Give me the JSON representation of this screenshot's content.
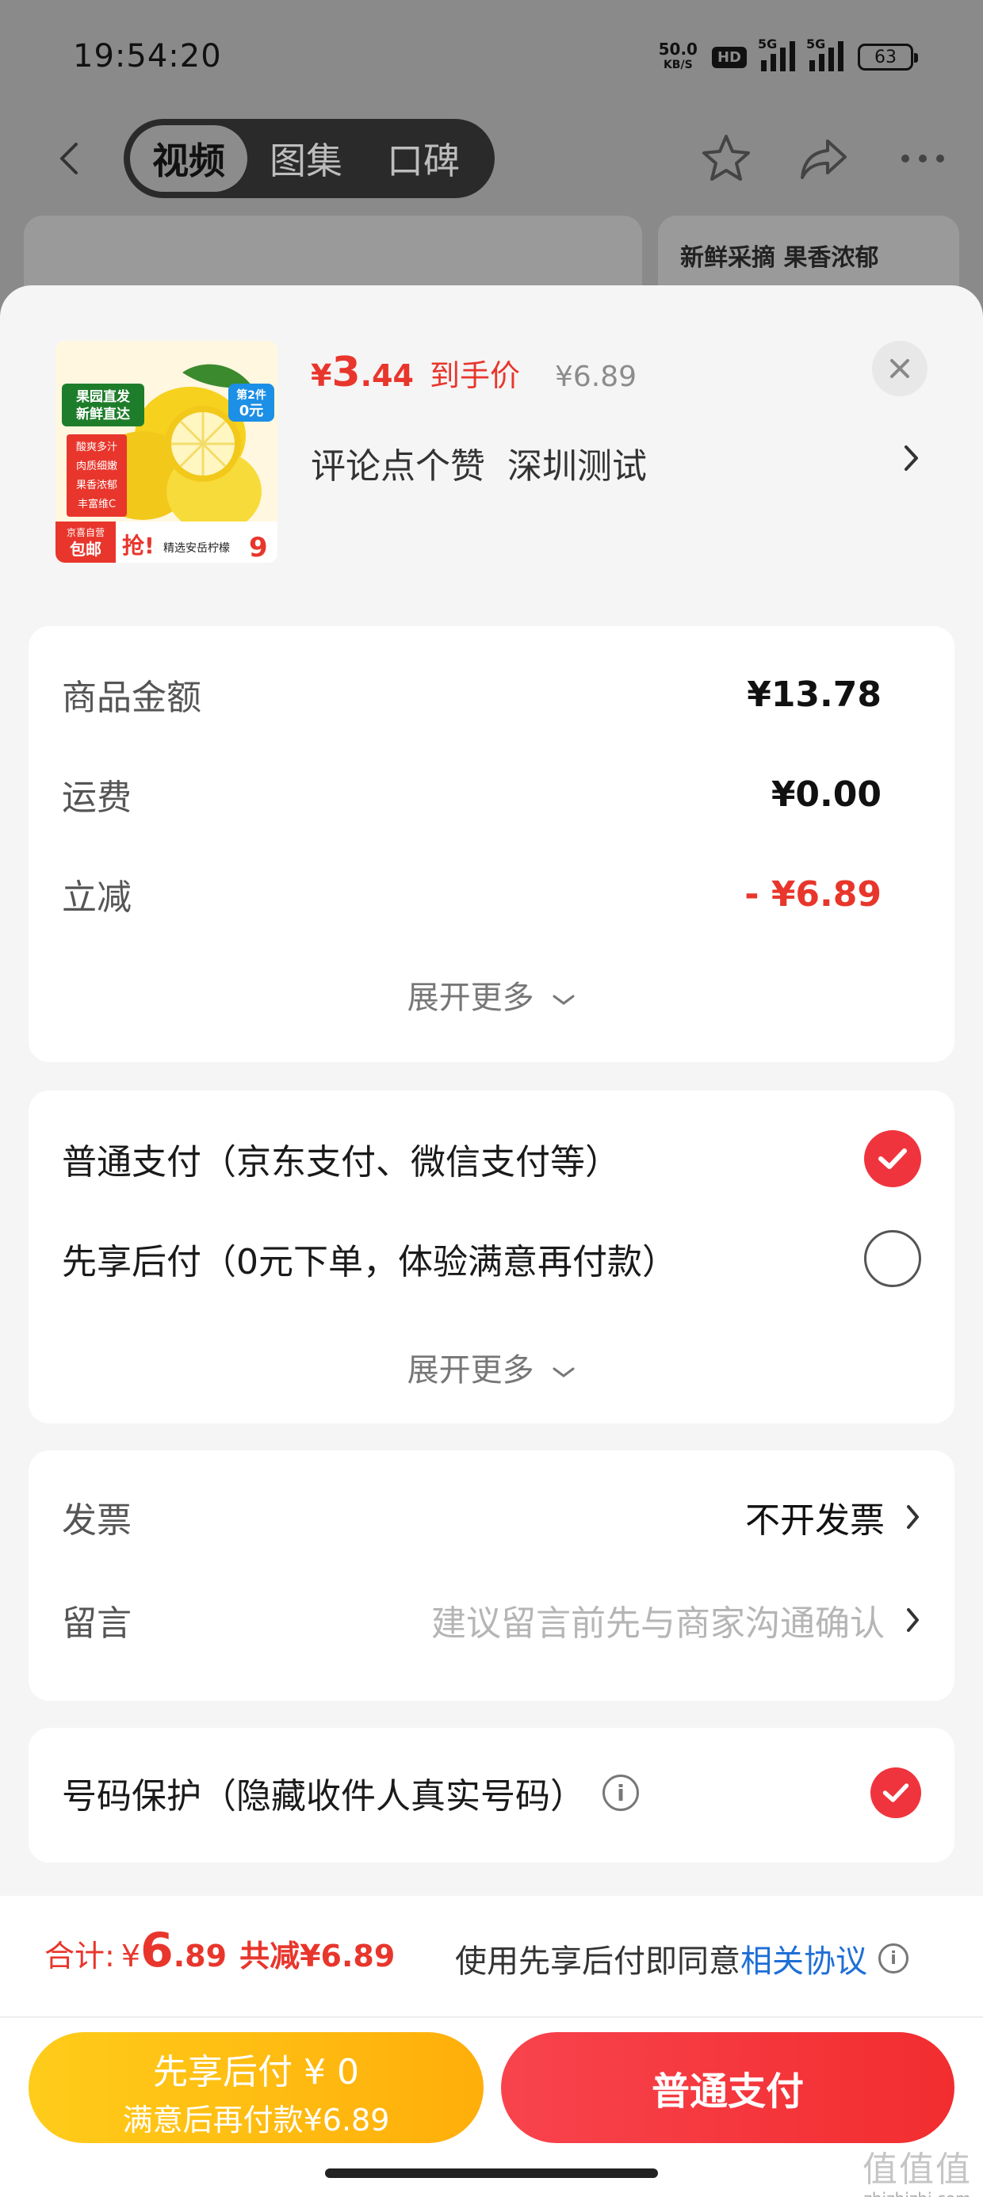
{
  "status": {
    "time": "19:54:20",
    "net_speed_value": "50.0",
    "net_speed_unit": "KB/S",
    "hd": "HD",
    "sig1": "5G",
    "sig2": "5G",
    "battery": "63"
  },
  "nav": {
    "tabs": [
      "视频",
      "图集",
      "口碑"
    ],
    "active_tab": "视频",
    "bg_card_text": "新鲜采摘 果香浓郁"
  },
  "product": {
    "thumb_badges": {
      "top_left": "果园直发 新鲜直达",
      "promo": "第2件 0元",
      "features": "酸爽多汁 肉质细嫩 果香浓郁 丰富维C",
      "ship_label": "京喜自营",
      "ship": "包邮",
      "grab": "抢!",
      "grab_desc": "精选安岳柠檬",
      "grab_num": "9"
    },
    "price_symbol": "¥",
    "price_int": "3",
    "price_dec": ".44",
    "price_tag": "到手价",
    "price_old": "¥6.89",
    "sub_1": "评论点个赞",
    "sub_2": "深圳测试"
  },
  "summary": {
    "rows": [
      {
        "label": "商品金额",
        "value": "¥13.78"
      },
      {
        "label": "运费",
        "value": "¥0.00"
      },
      {
        "label": "立减",
        "value": "- ¥6.89"
      }
    ],
    "more": "展开更多"
  },
  "payment": {
    "options": [
      {
        "label": "普通支付（京东支付、微信支付等）",
        "checked": true
      },
      {
        "label": "先享后付（0元下单，体验满意再付款）",
        "checked": false
      }
    ],
    "more": "展开更多"
  },
  "extras": {
    "invoice_label": "发票",
    "invoice_value": "不开发票",
    "note_label": "留言",
    "note_placeholder": "建议留言前先与商家沟通确认"
  },
  "privacy": {
    "label": "号码保护（隐藏收件人真实号码）",
    "checked": true
  },
  "footer": {
    "total_label": "合计:",
    "total_symbol": "¥",
    "total_int": "6",
    "total_dec": ".89",
    "saved": "共减¥6.89",
    "agree_text": "使用先享后付即同意",
    "agree_link": "相关协议",
    "btn_later_l1": "先享后付 ¥ 0",
    "btn_later_l2": "满意后再付款¥6.89",
    "btn_pay": "普通支付",
    "watermark_big": "值值值",
    "watermark_small": "zhizhizhi.com"
  },
  "colors": {
    "accent_red": "#e8362c",
    "check_red": "#f0343d",
    "link_blue": "#1f6fd6",
    "later_yellow": "#ffbf12"
  }
}
